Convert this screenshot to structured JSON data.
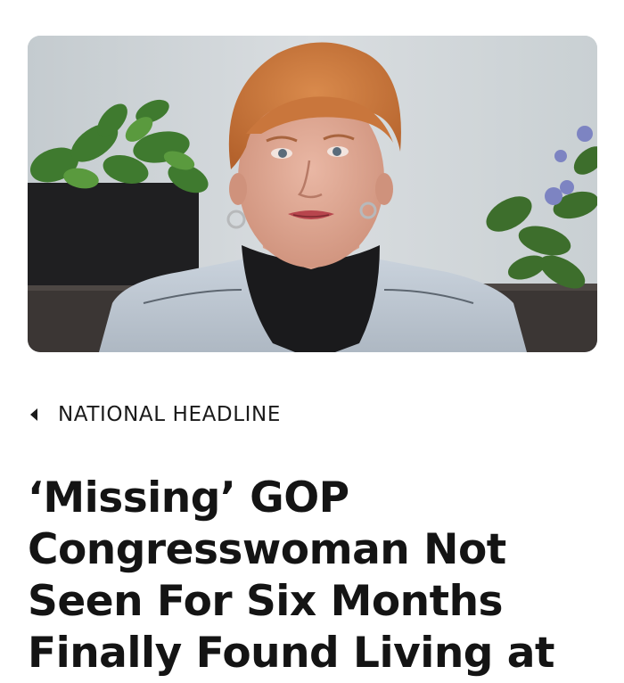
{
  "article": {
    "image": {
      "subject": "woman-interview-photo"
    },
    "category": {
      "label": "NATIONAL HEADLINE",
      "icon": "back-arrow-icon"
    },
    "headline": "‘Missing’ GOP\nCongresswoman Not\nSeen For Six Months\nFinally Found Living at"
  },
  "colors": {
    "text": "#141414",
    "background": "#ffffff"
  }
}
